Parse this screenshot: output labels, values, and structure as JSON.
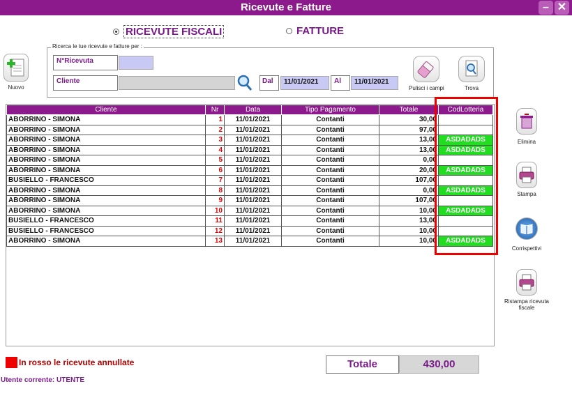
{
  "window": {
    "title": "Ricevute e Fatture",
    "minimize_label": "–",
    "close_label": "✕"
  },
  "mode": {
    "ricevute_label": "RICEVUTE FISCALI",
    "fatture_label": "FATTURE",
    "selected": "ricevute"
  },
  "search": {
    "legend": "Ricerca le tue ricevute e fatture per :",
    "nricevuta_label": "N°Ricevuta",
    "nricevuta_value": "",
    "cliente_label": "Cliente",
    "cliente_value": "",
    "dal_label": "Dal",
    "dal_value": "11/01/2021",
    "al_label": "Al",
    "al_value": "11/01/2021"
  },
  "buttons": {
    "nuovo": "Nuovo",
    "pulisci": "Pulisci i campi",
    "trova": "Trova",
    "elimina": "Elimina",
    "stampa": "Stampa",
    "corrispettivi": "Corrispettivi",
    "ristampa": "Ristampa ricevuta fiscale"
  },
  "table": {
    "headers": [
      "Cliente",
      "Nr",
      "Data",
      "Tipo Pagamento",
      "Totale",
      "CodLotteria"
    ],
    "rows": [
      [
        "ABORRINO - SIMONA",
        "1",
        "11/01/2021",
        "Contanti",
        "30,00",
        ""
      ],
      [
        "ABORRINO - SIMONA",
        "2",
        "11/01/2021",
        "Contanti",
        "97,00",
        ""
      ],
      [
        "ABORRINO - SIMONA",
        "3",
        "11/01/2021",
        "Contanti",
        "13,00",
        "ASDADADS"
      ],
      [
        "ABORRINO - SIMONA",
        "4",
        "11/01/2021",
        "Contanti",
        "13,00",
        "ASDADADS"
      ],
      [
        "ABORRINO - SIMONA",
        "5",
        "11/01/2021",
        "Contanti",
        "0,00",
        ""
      ],
      [
        "ABORRINO - SIMONA",
        "6",
        "11/01/2021",
        "Contanti",
        "20,00",
        "ASDADADS"
      ],
      [
        "BUSIELLO - FRANCESCO",
        "7",
        "11/01/2021",
        "Contanti",
        "107,00",
        ""
      ],
      [
        "ABORRINO - SIMONA",
        "8",
        "11/01/2021",
        "Contanti",
        "0,00",
        "ASDADADS"
      ],
      [
        "ABORRINO - SIMONA",
        "9",
        "11/01/2021",
        "Contanti",
        "107,00",
        ""
      ],
      [
        "ABORRINO - SIMONA",
        "10",
        "11/01/2021",
        "Contanti",
        "10,00",
        "ASDADADS"
      ],
      [
        "BUSIELLO - FRANCESCO",
        "11",
        "11/01/2021",
        "Contanti",
        "13,00",
        ""
      ],
      [
        "BUSIELLO - FRANCESCO",
        "12",
        "11/01/2021",
        "Contanti",
        "10,00",
        ""
      ],
      [
        "ABORRINO - SIMONA",
        "13",
        "11/01/2021",
        "Contanti",
        "10,00",
        "ASDADADS"
      ]
    ]
  },
  "footer": {
    "legend_text": "In rosso le ricevute annullate",
    "totale_label": "Totale",
    "totale_value": "430,00",
    "user_text": "Utente corrente: UTENTE"
  },
  "colors": {
    "brand": "#8c1a8c",
    "highlight": "#ee0000",
    "lottery": "#22dd22",
    "nr": "#e00000"
  }
}
